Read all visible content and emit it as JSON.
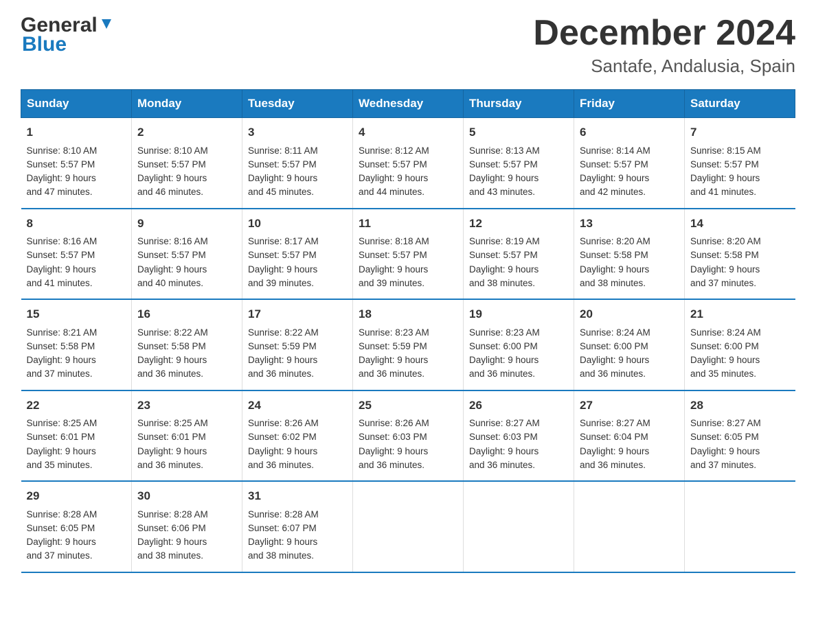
{
  "logo": {
    "general_text": "General",
    "blue_text": "Blue"
  },
  "header": {
    "month": "December 2024",
    "location": "Santafe, Andalusia, Spain"
  },
  "weekdays": [
    "Sunday",
    "Monday",
    "Tuesday",
    "Wednesday",
    "Thursday",
    "Friday",
    "Saturday"
  ],
  "weeks": [
    [
      {
        "day": "1",
        "sunrise": "8:10 AM",
        "sunset": "5:57 PM",
        "daylight": "9 hours and 47 minutes."
      },
      {
        "day": "2",
        "sunrise": "8:10 AM",
        "sunset": "5:57 PM",
        "daylight": "9 hours and 46 minutes."
      },
      {
        "day": "3",
        "sunrise": "8:11 AM",
        "sunset": "5:57 PM",
        "daylight": "9 hours and 45 minutes."
      },
      {
        "day": "4",
        "sunrise": "8:12 AM",
        "sunset": "5:57 PM",
        "daylight": "9 hours and 44 minutes."
      },
      {
        "day": "5",
        "sunrise": "8:13 AM",
        "sunset": "5:57 PM",
        "daylight": "9 hours and 43 minutes."
      },
      {
        "day": "6",
        "sunrise": "8:14 AM",
        "sunset": "5:57 PM",
        "daylight": "9 hours and 42 minutes."
      },
      {
        "day": "7",
        "sunrise": "8:15 AM",
        "sunset": "5:57 PM",
        "daylight": "9 hours and 41 minutes."
      }
    ],
    [
      {
        "day": "8",
        "sunrise": "8:16 AM",
        "sunset": "5:57 PM",
        "daylight": "9 hours and 41 minutes."
      },
      {
        "day": "9",
        "sunrise": "8:16 AM",
        "sunset": "5:57 PM",
        "daylight": "9 hours and 40 minutes."
      },
      {
        "day": "10",
        "sunrise": "8:17 AM",
        "sunset": "5:57 PM",
        "daylight": "9 hours and 39 minutes."
      },
      {
        "day": "11",
        "sunrise": "8:18 AM",
        "sunset": "5:57 PM",
        "daylight": "9 hours and 39 minutes."
      },
      {
        "day": "12",
        "sunrise": "8:19 AM",
        "sunset": "5:57 PM",
        "daylight": "9 hours and 38 minutes."
      },
      {
        "day": "13",
        "sunrise": "8:20 AM",
        "sunset": "5:58 PM",
        "daylight": "9 hours and 38 minutes."
      },
      {
        "day": "14",
        "sunrise": "8:20 AM",
        "sunset": "5:58 PM",
        "daylight": "9 hours and 37 minutes."
      }
    ],
    [
      {
        "day": "15",
        "sunrise": "8:21 AM",
        "sunset": "5:58 PM",
        "daylight": "9 hours and 37 minutes."
      },
      {
        "day": "16",
        "sunrise": "8:22 AM",
        "sunset": "5:58 PM",
        "daylight": "9 hours and 36 minutes."
      },
      {
        "day": "17",
        "sunrise": "8:22 AM",
        "sunset": "5:59 PM",
        "daylight": "9 hours and 36 minutes."
      },
      {
        "day": "18",
        "sunrise": "8:23 AM",
        "sunset": "5:59 PM",
        "daylight": "9 hours and 36 minutes."
      },
      {
        "day": "19",
        "sunrise": "8:23 AM",
        "sunset": "6:00 PM",
        "daylight": "9 hours and 36 minutes."
      },
      {
        "day": "20",
        "sunrise": "8:24 AM",
        "sunset": "6:00 PM",
        "daylight": "9 hours and 36 minutes."
      },
      {
        "day": "21",
        "sunrise": "8:24 AM",
        "sunset": "6:00 PM",
        "daylight": "9 hours and 35 minutes."
      }
    ],
    [
      {
        "day": "22",
        "sunrise": "8:25 AM",
        "sunset": "6:01 PM",
        "daylight": "9 hours and 35 minutes."
      },
      {
        "day": "23",
        "sunrise": "8:25 AM",
        "sunset": "6:01 PM",
        "daylight": "9 hours and 36 minutes."
      },
      {
        "day": "24",
        "sunrise": "8:26 AM",
        "sunset": "6:02 PM",
        "daylight": "9 hours and 36 minutes."
      },
      {
        "day": "25",
        "sunrise": "8:26 AM",
        "sunset": "6:03 PM",
        "daylight": "9 hours and 36 minutes."
      },
      {
        "day": "26",
        "sunrise": "8:27 AM",
        "sunset": "6:03 PM",
        "daylight": "9 hours and 36 minutes."
      },
      {
        "day": "27",
        "sunrise": "8:27 AM",
        "sunset": "6:04 PM",
        "daylight": "9 hours and 36 minutes."
      },
      {
        "day": "28",
        "sunrise": "8:27 AM",
        "sunset": "6:05 PM",
        "daylight": "9 hours and 37 minutes."
      }
    ],
    [
      {
        "day": "29",
        "sunrise": "8:28 AM",
        "sunset": "6:05 PM",
        "daylight": "9 hours and 37 minutes."
      },
      {
        "day": "30",
        "sunrise": "8:28 AM",
        "sunset": "6:06 PM",
        "daylight": "9 hours and 38 minutes."
      },
      {
        "day": "31",
        "sunrise": "8:28 AM",
        "sunset": "6:07 PM",
        "daylight": "9 hours and 38 minutes."
      },
      null,
      null,
      null,
      null
    ]
  ],
  "labels": {
    "sunrise": "Sunrise:",
    "sunset": "Sunset:",
    "daylight": "Daylight:"
  }
}
